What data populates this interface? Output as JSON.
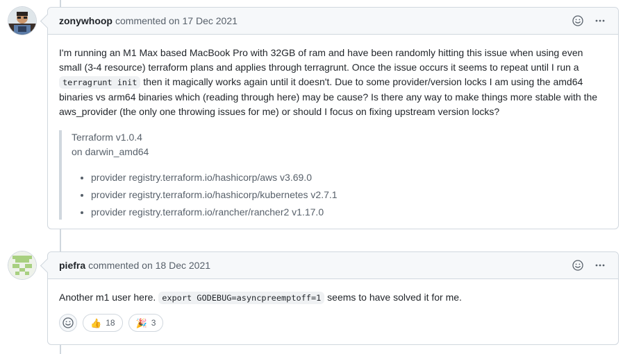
{
  "comments": [
    {
      "author": "zonywhoop",
      "meta": "commented on 17 Dec 2021",
      "body": {
        "paragraph_parts": [
          "I'm running an M1 Max based MacBook Pro with 32GB of ram and have been randomly hitting this issue when using even small (3-4 resource) terraform plans and applies through terragrunt. Once the issue occurs it seems to repeat until I run a ",
          "terragrunt init",
          " then it magically works again until it doesn't. Due to some provider/version locks I am using the amd64 binaries vs arm64 binaries which (reading through here) may be cause? Is there any way to make things more stable with the aws_provider (the only one throwing issues for me) or should I focus on fixing upstream version locks?"
        ],
        "quote": {
          "line1": "Terraform v1.0.4",
          "line2": "on darwin_amd64",
          "providers": [
            "provider registry.terraform.io/hashicorp/aws v3.69.0",
            "provider registry.terraform.io/hashicorp/kubernetes v2.7.1",
            "provider registry.terraform.io/rancher/rancher2 v1.17.0"
          ]
        }
      }
    },
    {
      "author": "piefra",
      "meta": "commented on 18 Dec 2021",
      "body": {
        "text_before": "Another m1 user here. ",
        "code": "export GODEBUG=asyncpreemptoff=1",
        "text_after": " seems to have solved it for me."
      },
      "reactions": [
        {
          "emoji": "👍",
          "icon": "thumbs-up-icon",
          "count": "18"
        },
        {
          "emoji": "🎉",
          "icon": "party-popper-icon",
          "count": "3"
        }
      ]
    }
  ],
  "icons": {
    "add_reaction": "smiley-icon",
    "more_options": "kebab-horizontal-icon"
  },
  "colors": {
    "border": "#d0d7de",
    "header_bg": "#f6f8fa",
    "text": "#1f2328",
    "muted": "#57606a"
  }
}
